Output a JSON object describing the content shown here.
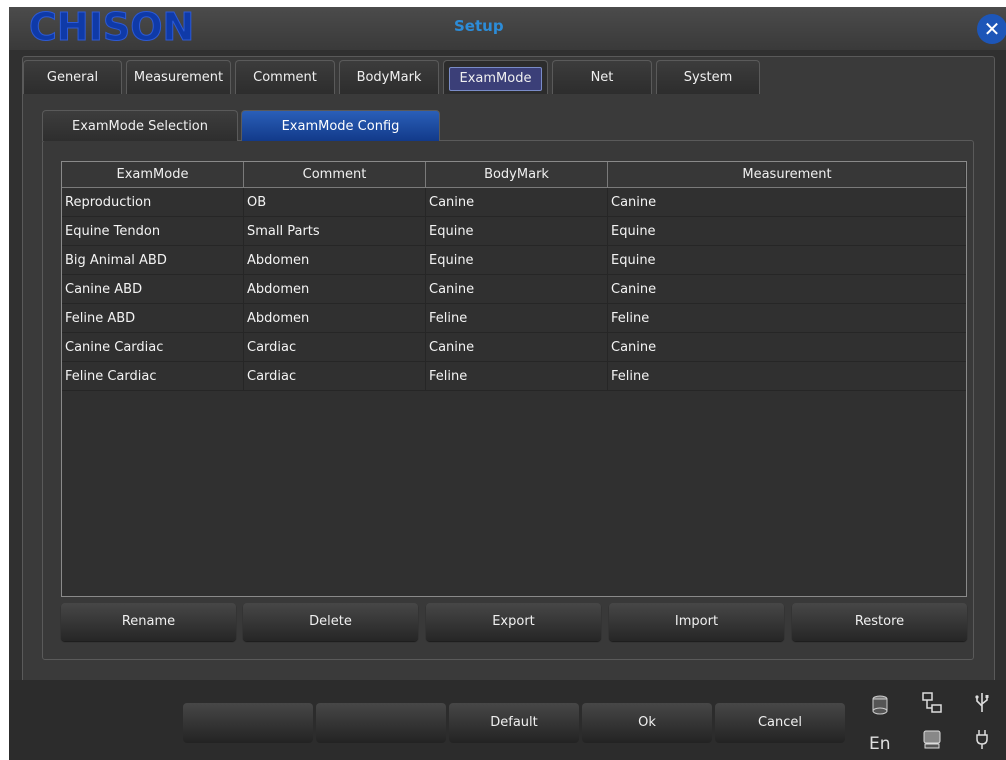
{
  "app": {
    "logo": "CHISON",
    "title": "Setup"
  },
  "colors": {
    "accent": "#1d56b8",
    "title_blue": "#2c8cd8",
    "background": "#303030"
  },
  "icons": {
    "close": "close-icon"
  },
  "tabs": [
    "General",
    "Measurement",
    "Comment",
    "BodyMark",
    "ExamMode",
    "Net",
    "System"
  ],
  "active_tab": "ExamMode",
  "subtabs": [
    "ExamMode Selection",
    "ExamMode Config"
  ],
  "active_subtab": "ExamMode Config",
  "table": {
    "columns": [
      "ExamMode",
      "Comment",
      "BodyMark",
      "Measurement"
    ],
    "rows": [
      [
        "Reproduction",
        "OB",
        "Canine",
        "Canine"
      ],
      [
        "Equine Tendon",
        "Small Parts",
        "Equine",
        "Equine"
      ],
      [
        "Big Animal ABD",
        "Abdomen",
        "Equine",
        "Equine"
      ],
      [
        "Canine ABD",
        "Abdomen",
        "Canine",
        "Canine"
      ],
      [
        "Feline ABD",
        "Abdomen",
        "Feline",
        "Feline"
      ],
      [
        "Canine Cardiac",
        "Cardiac",
        "Canine",
        "Canine"
      ],
      [
        "Feline Cardiac",
        "Cardiac",
        "Feline",
        "Feline"
      ]
    ]
  },
  "actions": [
    "Rename",
    "Delete",
    "Export",
    "Import",
    "Restore"
  ],
  "footer": {
    "buttons": [
      "",
      "",
      "Default",
      "Ok",
      "Cancel"
    ]
  },
  "status": {
    "language": "En",
    "icons": [
      "disk-icon",
      "network-icon",
      "usb-icon",
      "printer-icon",
      "plug-icon"
    ]
  }
}
